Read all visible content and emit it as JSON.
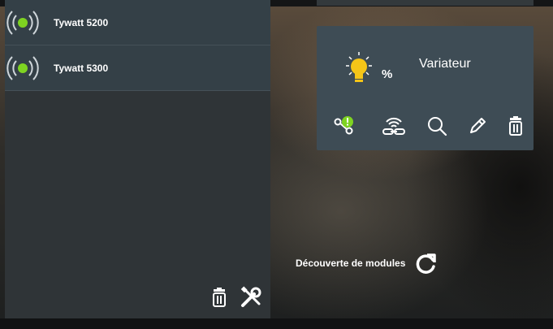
{
  "devices": [
    {
      "name": "Tywatt 5200",
      "status_icon": "signal-online-icon",
      "status_color": "#7ed321"
    },
    {
      "name": "Tywatt 5300",
      "status_icon": "signal-online-icon",
      "status_color": "#7ed321"
    }
  ],
  "sidebar": {
    "actions": [
      {
        "icon": "trash-icon"
      },
      {
        "icon": "settings-tools-icon"
      }
    ]
  },
  "module": {
    "icon": "lightbulb-icon",
    "bulb_color": "#f5c518",
    "unit": "%",
    "name": "Variateur",
    "actions": [
      {
        "icon": "pairing-warning-icon",
        "warning_color": "#7ed321"
      },
      {
        "icon": "wireless-link-icon"
      },
      {
        "icon": "search-icon"
      },
      {
        "icon": "edit-icon"
      },
      {
        "icon": "trash-icon"
      }
    ]
  },
  "discovery": {
    "label": "Découverte de modules",
    "icon": "refresh-icon"
  }
}
